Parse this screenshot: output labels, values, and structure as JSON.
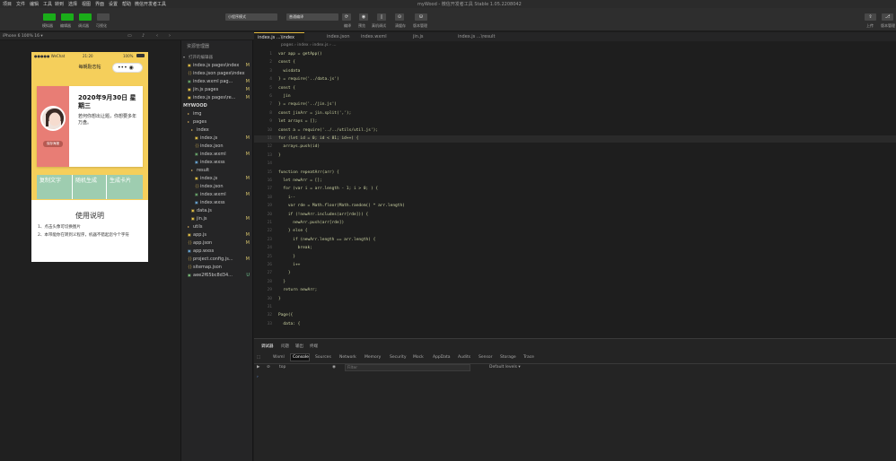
{
  "menu": [
    "项目",
    "文件",
    "编辑",
    "工具",
    "转到",
    "选择",
    "视图",
    "界面",
    "设置",
    "帮助",
    "微信开发者工具"
  ],
  "window_title": "myWood - 微信开发者工具 Stable 1.05.2208042",
  "toolbar": {
    "simulator": "模拟器",
    "editor": "编辑器",
    "debugger": "调试器",
    "visual": "可视化",
    "compile_mode": "小程序模式",
    "compile_target": "普通编译",
    "compile": "编译",
    "preview": "预览",
    "real_debug": "真机调试",
    "clear_cache": "清缓存",
    "upload": "上传",
    "version": "版本管理",
    "upload_short": "上传",
    "version_short": "版本管理"
  },
  "subbar": {
    "device": "iPhone 6 100% 16 ▾"
  },
  "phone": {
    "status": {
      "signal": "●●●●● WeChat",
      "time": "21:20",
      "battery": "100%"
    },
    "nav_title": "每朝励志帖",
    "capsule": "••• ◉",
    "card": {
      "date": "2020年9月30日 星期三",
      "text": "若何你想出让题，你想要多年万盘。",
      "save": "保存海报"
    },
    "buttons": [
      "复制文字",
      "随机生成",
      "生成卡片"
    ],
    "usage": {
      "heading": "使用说明",
      "lines": [
        "1、点击头像可切换图片",
        "2、本带能你在转到义程序，机器不错起您今个字符"
      ]
    }
  },
  "tree": {
    "header": "资源管理器",
    "open_editors": "打开的编辑器",
    "project": "MYWOOD",
    "items": [
      {
        "label": "index.js pages\\index",
        "status": "M",
        "icon": "js",
        "indent": 1
      },
      {
        "label": "index.json pages\\index",
        "status": "",
        "icon": "json",
        "indent": 1
      },
      {
        "label": "index.wxml pag...",
        "status": "M",
        "icon": "wxml",
        "indent": 1
      },
      {
        "label": "jin.js pages",
        "status": "M",
        "icon": "js",
        "indent": 1
      },
      {
        "label": "index.js pages\\re...",
        "status": "M",
        "icon": "js",
        "indent": 1
      },
      {
        "label": "img",
        "status": "",
        "icon": "folder",
        "indent": 1
      },
      {
        "label": "pages",
        "status": "",
        "icon": "folder",
        "indent": 1
      },
      {
        "label": "index",
        "status": "",
        "icon": "folder",
        "indent": 2
      },
      {
        "label": "index.js",
        "status": "M",
        "icon": "js",
        "indent": 3
      },
      {
        "label": "index.json",
        "status": "",
        "icon": "json",
        "indent": 3
      },
      {
        "label": "index.wxml",
        "status": "M",
        "icon": "wxml",
        "indent": 3
      },
      {
        "label": "index.wxss",
        "status": "",
        "icon": "wxss",
        "indent": 3
      },
      {
        "label": "result",
        "status": "",
        "icon": "folder",
        "indent": 2
      },
      {
        "label": "index.js",
        "status": "M",
        "icon": "js",
        "indent": 3
      },
      {
        "label": "index.json",
        "status": "",
        "icon": "json",
        "indent": 3
      },
      {
        "label": "index.wxml",
        "status": "M",
        "icon": "wxml",
        "indent": 3
      },
      {
        "label": "index.wxss",
        "status": "",
        "icon": "wxss",
        "indent": 3
      },
      {
        "label": "data.js",
        "status": "",
        "icon": "js",
        "indent": 2
      },
      {
        "label": "jin.js",
        "status": "M",
        "icon": "js",
        "indent": 2
      },
      {
        "label": "utils",
        "status": "",
        "icon": "folder",
        "indent": 1
      },
      {
        "label": "app.js",
        "status": "M",
        "icon": "js",
        "indent": 1
      },
      {
        "label": "app.json",
        "status": "M",
        "icon": "json",
        "indent": 1
      },
      {
        "label": "app.wxss",
        "status": "",
        "icon": "wxss",
        "indent": 1
      },
      {
        "label": "project.config.js...",
        "status": "M",
        "icon": "json",
        "indent": 1
      },
      {
        "label": "sitemap.json",
        "status": "",
        "icon": "json",
        "indent": 1
      },
      {
        "label": "aee2f65bc8d34...",
        "status": "U",
        "icon": "img",
        "indent": 1
      }
    ]
  },
  "tabs": [
    {
      "label": "index.js ...\\index",
      "active": true
    },
    {
      "label": "index.json",
      "active": false
    },
    {
      "label": "index.wxml",
      "active": false
    },
    {
      "label": "jin.js",
      "active": false
    },
    {
      "label": "index.js ...\\result",
      "active": false
    }
  ],
  "breadcrumb": "pages › index › index.js › ...",
  "code": [
    "var app = getApp()",
    "const {",
    "  wisdata",
    "} = require('../data.js')",
    "const {",
    "  jin",
    "} = require('../jin.js')",
    "const jinArr = jin.split(',');",
    "let arrays = [];",
    "const a = require('../../utils/util.js');",
    "for (let id = 0; id < 81; id++) {",
    "  arrays.push(id)",
    "}",
    "",
    "function repeatArr(arr) {",
    "  let newArr = [];",
    "  for (var i = arr.length - 1; i > 0; ) {",
    "    i--",
    "    var rde = Math.floor(Math.random() * arr.length)",
    "    if (!newArr.includes(arr[rde])) {",
    "      newArr.push(arr[rde])",
    "    } else {",
    "      if (newArr.length == arr.length) {",
    "        break;",
    "      }",
    "      i++",
    "    }",
    "  }",
    "  return newArr;",
    "}",
    "",
    "Page({",
    "  data: {"
  ],
  "devtools": {
    "top_tabs": [
      "调试器",
      "问题",
      "输出",
      "终端"
    ],
    "tabs": [
      "Wxml",
      "Console",
      "Sources",
      "Network",
      "Memory",
      "Security",
      "Mock",
      "AppData",
      "Audits",
      "Sensor",
      "Storage",
      "Trace"
    ],
    "context": "top",
    "filter_placeholder": "Filter",
    "levels": "Default levels ▾",
    "prompt": "›"
  },
  "colors": {
    "accent": "#e2b93d",
    "phone_bg": "#f5cf5b",
    "card_left": "#e87d75",
    "button_green": "#9ecdb0"
  }
}
